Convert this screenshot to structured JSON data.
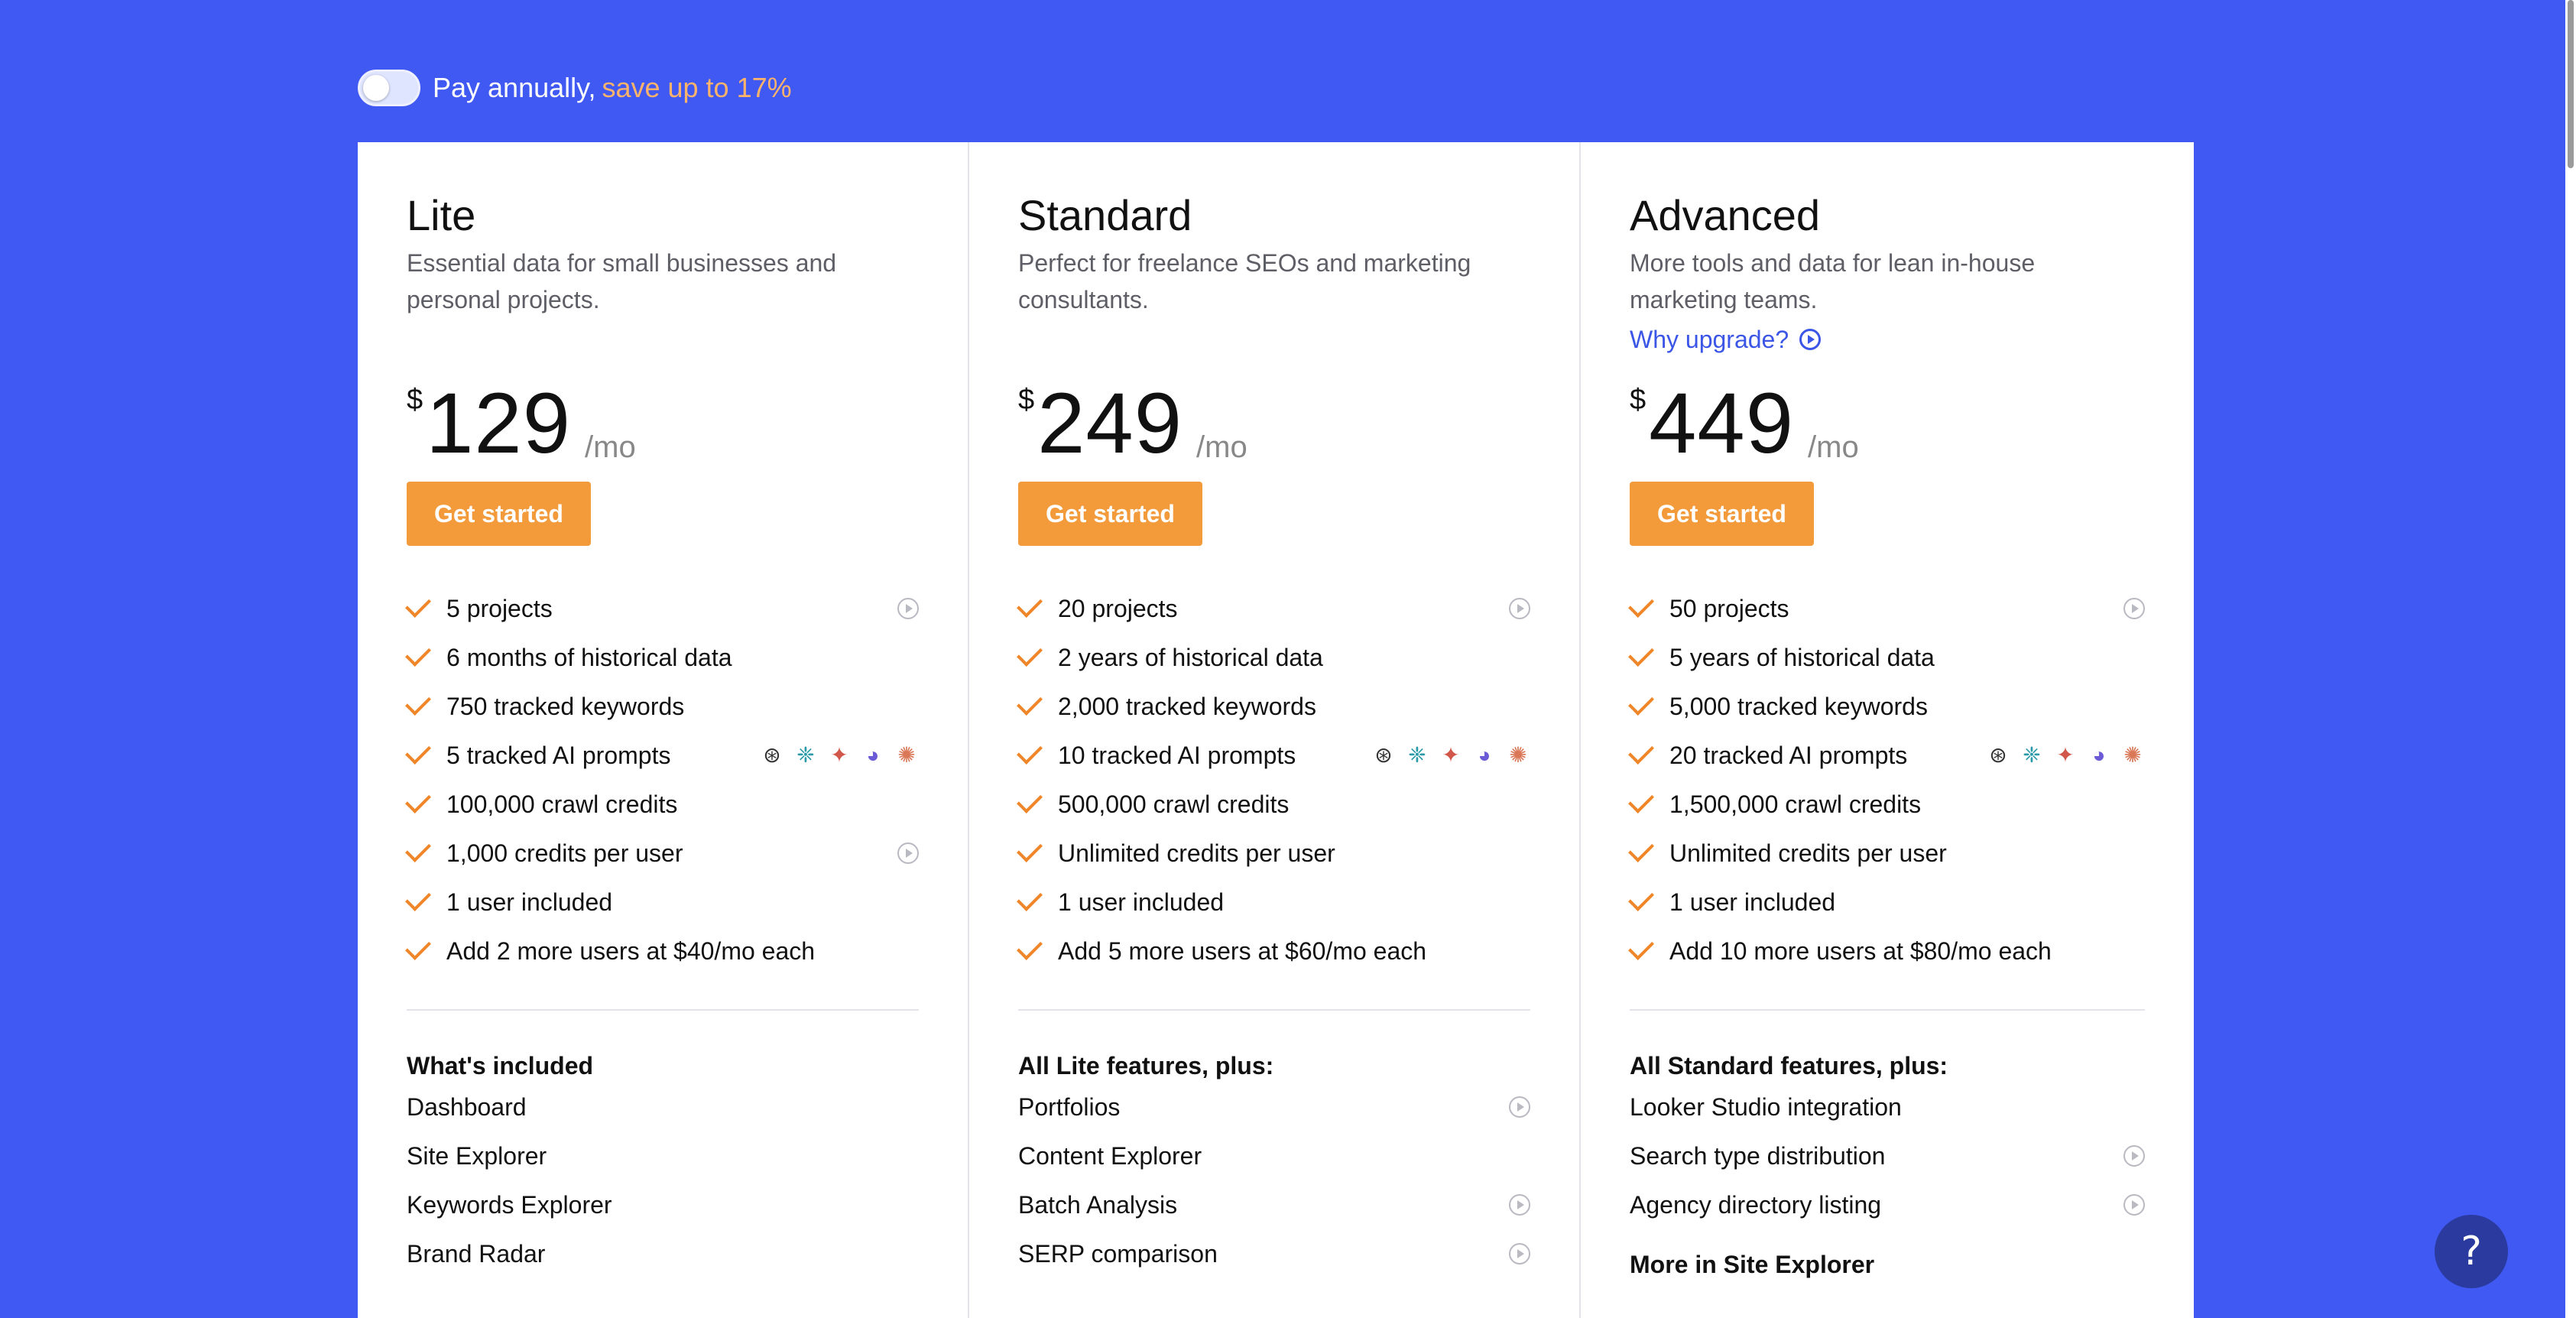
{
  "billing": {
    "toggle_label": "Pay annually,",
    "save_text": "save up to 17%",
    "annual_enabled": false
  },
  "plans": [
    {
      "name": "Lite",
      "description": "Essential data for small businesses and personal projects.",
      "currency": "$",
      "price": "129",
      "period": "/mo",
      "cta": "Get started",
      "features": [
        "5 projects",
        "6 months of historical data",
        "750 tracked keywords",
        "5 tracked AI prompts",
        "100,000 crawl credits",
        "1,000 credits per user",
        "1 user included",
        "Add 2 more users at $40/mo each"
      ],
      "included_title": "What's included",
      "included": [
        "Dashboard",
        "Site Explorer",
        "Keywords Explorer",
        "Brand Radar"
      ]
    },
    {
      "name": "Standard",
      "description": "Perfect for freelance SEOs and marketing consultants.",
      "currency": "$",
      "price": "249",
      "period": "/mo",
      "cta": "Get started",
      "features": [
        "20 projects",
        "2 years of historical data",
        "2,000 tracked keywords",
        "10 tracked AI prompts",
        "500,000 crawl credits",
        "Unlimited credits per user",
        "1 user included",
        "Add 5 more users at $60/mo each"
      ],
      "included_title": "All Lite features, plus:",
      "included": [
        "Portfolios",
        "Content Explorer",
        "Batch Analysis",
        "SERP comparison"
      ]
    },
    {
      "name": "Advanced",
      "description": "More tools and data for lean in-house marketing teams.",
      "why_upgrade": "Why upgrade?",
      "currency": "$",
      "price": "449",
      "period": "/mo",
      "cta": "Get started",
      "features": [
        "50 projects",
        "5 years of historical data",
        "5,000 tracked keywords",
        "20 tracked AI prompts",
        "1,500,000 crawl credits",
        "Unlimited credits per user",
        "1 user included",
        "Add 10 more users at $80/mo each"
      ],
      "included_title": "All Standard features, plus:",
      "included": [
        "Looker Studio integration",
        "Search type distribution",
        "Agency directory listing"
      ],
      "more_title": "More in Site Explorer"
    }
  ],
  "ai_icons": [
    "chatgpt-icon",
    "perplexity-icon",
    "gemini-icon",
    "copilot-icon",
    "claude-icon"
  ],
  "help_label": "?",
  "colors": {
    "background": "#4059f2",
    "cta": "#f39a3b",
    "check": "#f0862a",
    "link": "#3b55e6",
    "save_text": "#ffb36b"
  }
}
